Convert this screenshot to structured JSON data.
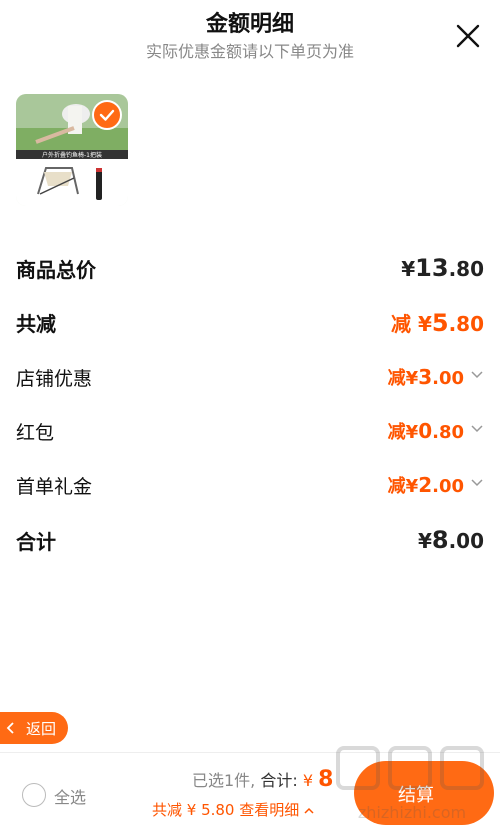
{
  "header": {
    "title": "金额明细",
    "subtitle": "实际优惠金额请以下单页为准"
  },
  "product": {
    "image_caption": "户外折叠钓鱼椅-1把装",
    "selected": true
  },
  "rows": [
    {
      "label": "商品总价",
      "prefix": "",
      "currency": "¥",
      "int": "13",
      "dec": ".80"
    },
    {
      "label": "共减",
      "prefix": "减",
      "currency": "¥",
      "int": "5",
      "dec": ".80"
    },
    {
      "label": "店铺优惠",
      "prefix": "减",
      "currency": "¥",
      "int": "3",
      "dec": ".00"
    },
    {
      "label": "红包",
      "prefix": "减",
      "currency": "¥",
      "int": "0",
      "dec": ".80"
    },
    {
      "label": "首单礼金",
      "prefix": "减",
      "currency": "¥",
      "int": "2",
      "dec": ".00"
    },
    {
      "label": "合计",
      "prefix": "",
      "currency": "¥",
      "int": "8",
      "dec": ".00"
    }
  ],
  "back_button": {
    "label": "返回"
  },
  "bottom_bar": {
    "select_all": "全选",
    "selected_count": "已选1件,",
    "total_label": "合计:",
    "currency": "¥",
    "total": "8",
    "savings": "共减 ¥ 5.80 查看明细",
    "checkout": "结算"
  },
  "watermark": "值 什么值得买 zhizhizhi.com",
  "colors": {
    "accent": "#ff6a14",
    "price_red": "#ff5500"
  }
}
